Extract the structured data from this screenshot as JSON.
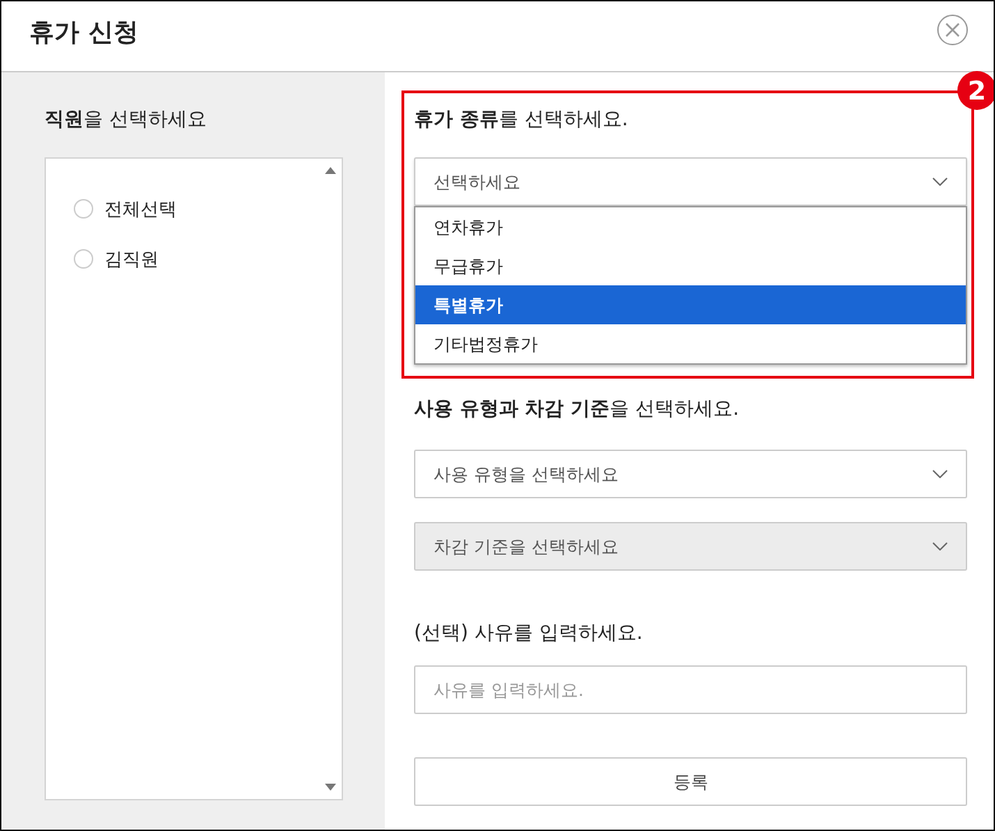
{
  "dialog": {
    "title": "휴가 신청"
  },
  "employees": {
    "label": "**직원**을 선택하세요",
    "items": [
      {
        "name": "전체선택",
        "selected": false
      },
      {
        "name": "김직원",
        "selected": false
      }
    ]
  },
  "leave_type": {
    "label": "**휴가 종류**를 선택하세요.",
    "placeholder": "선택하세요",
    "expanded": true,
    "options": [
      {
        "label": "연차휴가",
        "selected": false
      },
      {
        "label": "무급휴가",
        "selected": false
      },
      {
        "label": "특별휴가",
        "selected": true
      },
      {
        "label": "기타법정휴가",
        "selected": false
      }
    ]
  },
  "usage": {
    "label": "**사용 유형과 차감 기준**을 선택하세요.",
    "selects": [
      {
        "placeholder": "사용 유형을 선택하세요",
        "disabled": false
      },
      {
        "placeholder": "차감 기준을 선택하세요",
        "disabled": true
      }
    ]
  },
  "reason": {
    "label": "(선택) 사유를 입력하세요.",
    "placeholder": "사유를 입력하세요."
  },
  "submit": "등록",
  "annotation": {
    "number": "2"
  }
}
